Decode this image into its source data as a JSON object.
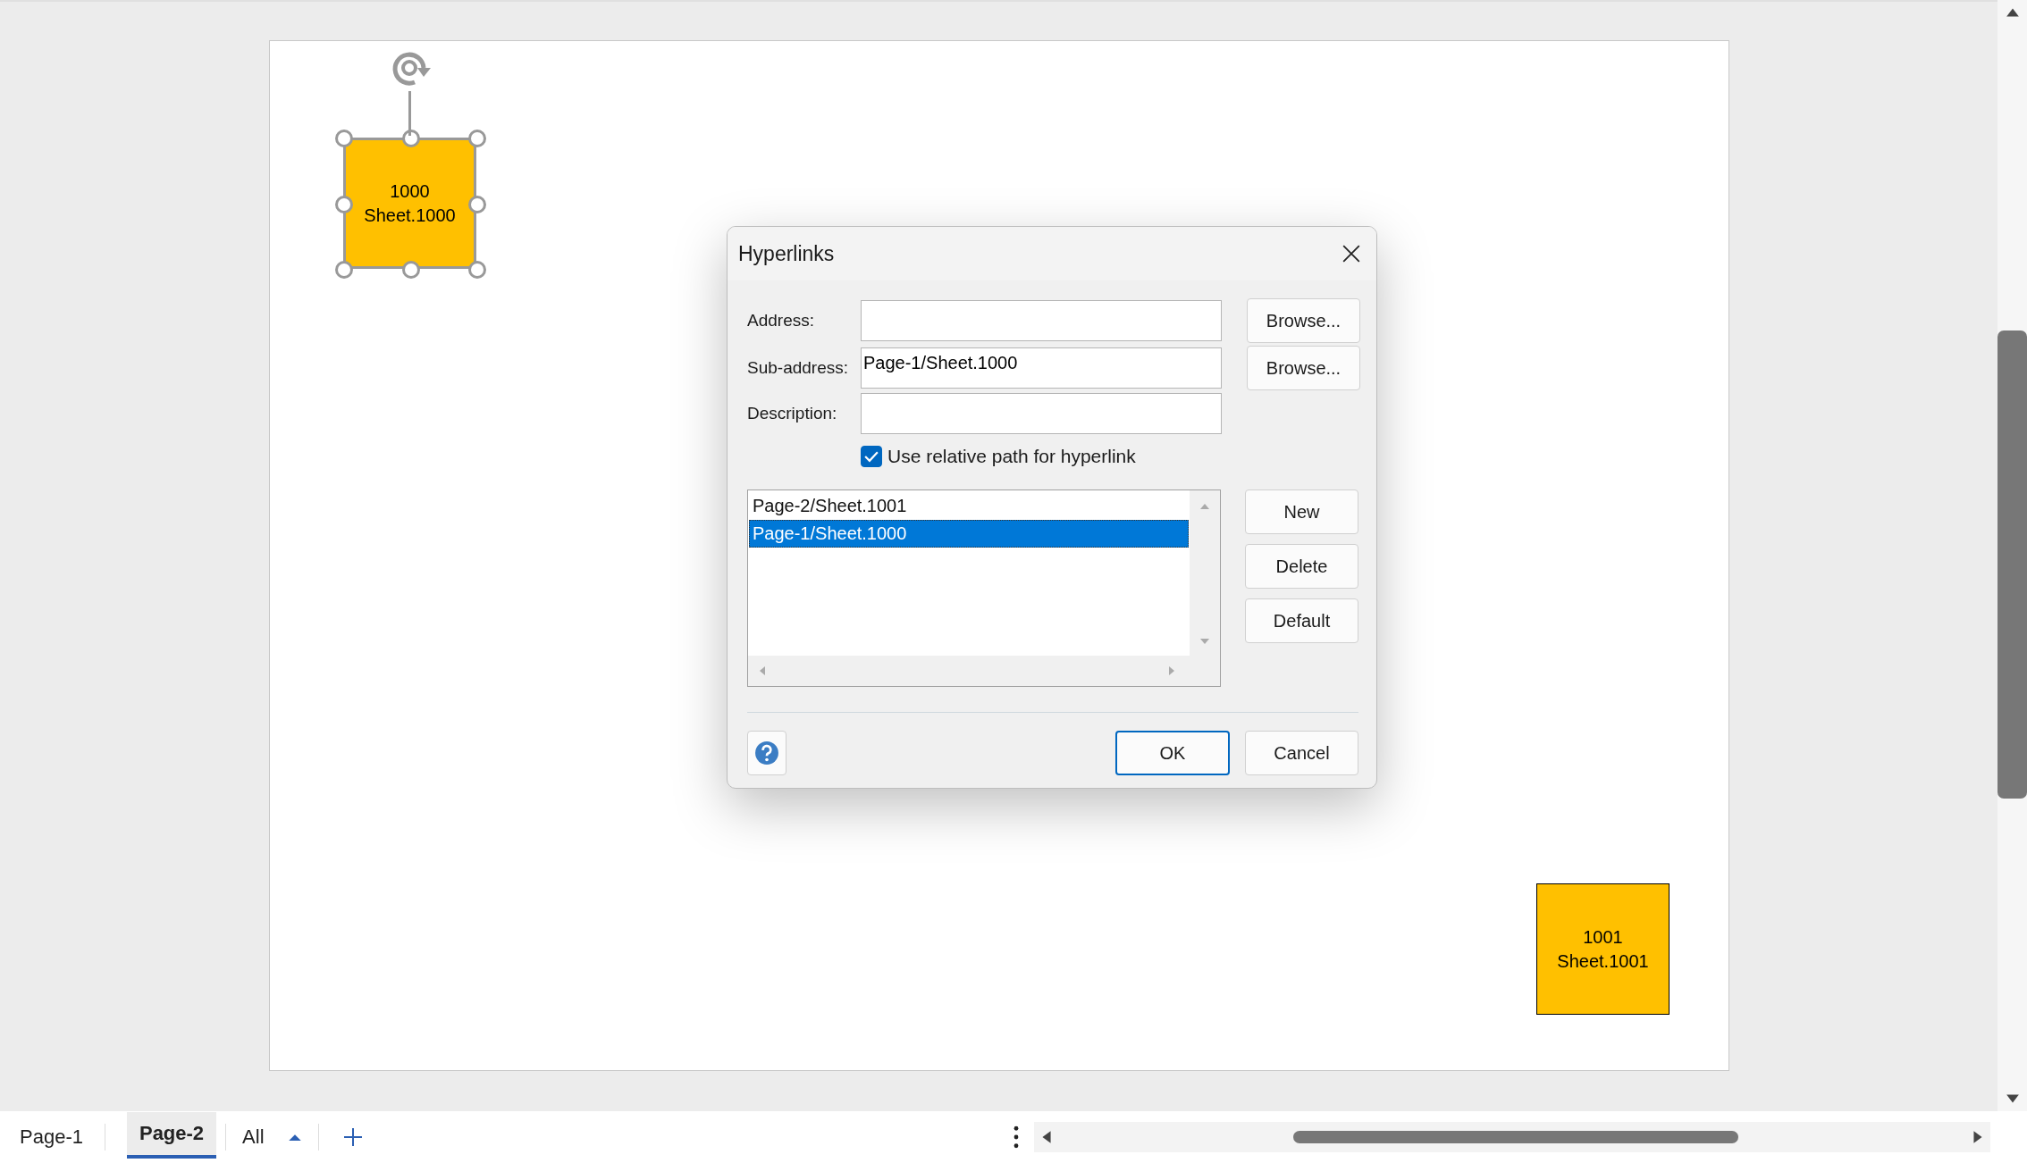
{
  "canvas": {
    "shapes": [
      {
        "number": "1000",
        "name": "Sheet.1000",
        "selected": true
      },
      {
        "number": "1001",
        "name": "Sheet.1001",
        "selected": false
      }
    ]
  },
  "dialog": {
    "title": "Hyperlinks",
    "fields": [
      {
        "label": "Address:",
        "browse": "Browse..."
      },
      {
        "label": "Sub-address:",
        "value": "Page-1/Sheet.1000",
        "browse": "Browse..."
      },
      {
        "label": "Description:"
      }
    ],
    "relative_path": {
      "label": "Use relative path for hyperlink",
      "checked": true
    },
    "links": [
      {
        "label": "Page-2/Sheet.1001",
        "selected": false
      },
      {
        "label": "Page-1/Sheet.1000",
        "selected": true
      }
    ],
    "list_buttons": [
      "New",
      "Delete",
      "Default"
    ],
    "footer_buttons": [
      {
        "label": "OK",
        "default": true
      },
      {
        "label": "Cancel",
        "default": false
      }
    ]
  },
  "page_tabs": [
    {
      "label": "Page-1",
      "selected": false
    },
    {
      "label": "Page-2",
      "selected": true
    }
  ],
  "all_pages_button": {
    "label": "All"
  }
}
